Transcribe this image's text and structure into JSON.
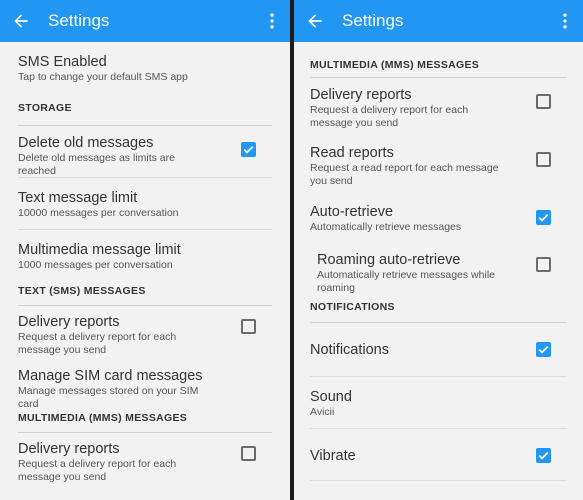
{
  "left": {
    "appbar": {
      "title": "Settings"
    },
    "sms": {
      "title": "SMS Enabled",
      "summary": "Tap to change your default SMS app"
    },
    "storage_header": "STORAGE",
    "delete_old": {
      "title": "Delete old messages",
      "summary": "Delete old messages as limits are reached",
      "checked": true
    },
    "text_limit": {
      "title": "Text message limit",
      "summary": "10000 messages per conversation"
    },
    "mms_limit": {
      "title": "Multimedia message limit",
      "summary": "1000 messages per conversation"
    },
    "sms_header": "TEXT (SMS) MESSAGES",
    "sms_delivery": {
      "title": "Delivery reports",
      "summary": "Request a delivery report for each message you send",
      "checked": false
    },
    "sim": {
      "title": "Manage SIM card messages",
      "summary": "Manage messages stored on your SIM card"
    },
    "mms_header": "MULTIMEDIA (MMS) MESSAGES",
    "mms_delivery": {
      "title": "Delivery reports",
      "summary": "Request a delivery report for each message you send",
      "checked": false
    }
  },
  "right": {
    "appbar": {
      "title": "Settings"
    },
    "mms_header": "MULTIMEDIA (MMS) MESSAGES",
    "delivery": {
      "title": "Delivery reports",
      "summary": "Request a delivery report for each message you send",
      "checked": false
    },
    "read": {
      "title": "Read reports",
      "summary": "Request a read report for each message you send",
      "checked": false
    },
    "auto": {
      "title": "Auto-retrieve",
      "summary": "Automatically retrieve messages",
      "checked": true
    },
    "roaming": {
      "title": "Roaming auto-retrieve",
      "summary": "Automatically retrieve messages while roaming",
      "checked": false
    },
    "notif_header": "NOTIFICATIONS",
    "notifications": {
      "title": "Notifications",
      "checked": true
    },
    "sound": {
      "title": "Sound",
      "summary": "Avicii"
    },
    "vibrate": {
      "title": "Vibrate",
      "checked": true
    }
  },
  "colors": {
    "appbar": "#2196f3",
    "background": "#f2f2f2",
    "checkbox_on": "#2196f3",
    "text": "#333333"
  },
  "icons": {
    "back": "arrow-left-icon",
    "overflow": "more-vert-icon",
    "checked": "check-icon"
  }
}
